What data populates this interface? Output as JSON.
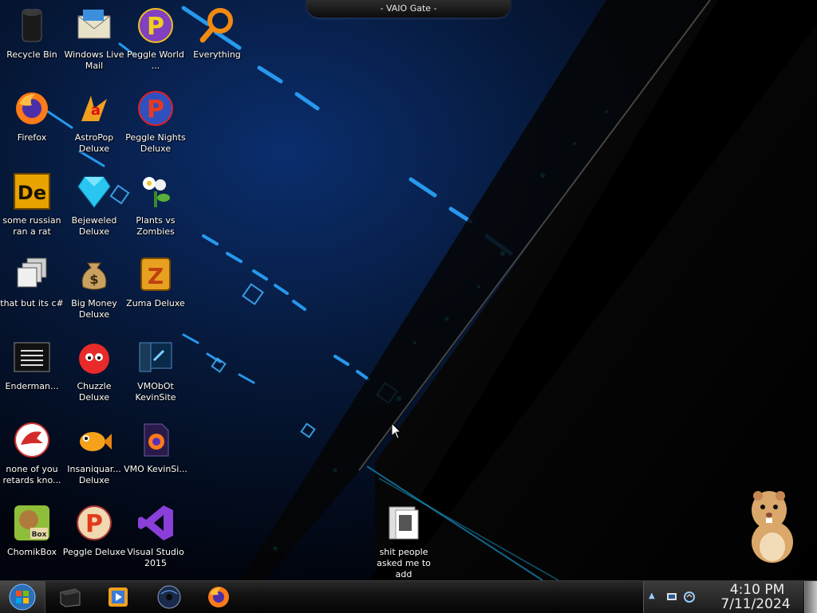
{
  "window": {
    "title": "- VAIO Gate -"
  },
  "desktop": {
    "icons": [
      {
        "label": "Recycle Bin"
      },
      {
        "label": "Windows Live Mail"
      },
      {
        "label": "Peggle World ..."
      },
      {
        "label": "Everything"
      },
      {
        "label": "Firefox"
      },
      {
        "label": "AstroPop Deluxe"
      },
      {
        "label": "Peggle Nights Deluxe"
      },
      {
        "label": "some russian ran a rat"
      },
      {
        "label": "Bejeweled Deluxe"
      },
      {
        "label": "Plants vs Zombies"
      },
      {
        "label": "that but its c#"
      },
      {
        "label": "Big Money Deluxe"
      },
      {
        "label": "Zuma Deluxe"
      },
      {
        "label": "Enderman..."
      },
      {
        "label": "Chuzzle Deluxe"
      },
      {
        "label": "VMObOt KevinSite"
      },
      {
        "label": "none of you retards kno..."
      },
      {
        "label": "Insaniquar... Deluxe"
      },
      {
        "label": "VMO KevinSi..."
      },
      {
        "label": "ChomikBox"
      },
      {
        "label": "Peggle Deluxe"
      },
      {
        "label": "Visual Studio 2015"
      },
      {
        "label": "shit people asked me to add"
      }
    ]
  },
  "taskbar": {
    "pinned": [
      {
        "icon": "media-center-icon"
      },
      {
        "icon": "media-player-icon"
      },
      {
        "icon": "dvd-player-icon"
      },
      {
        "icon": "firefox-icon"
      }
    ],
    "clock": {
      "time": "4:10 PM",
      "date": "7/11/2024"
    }
  },
  "colors": {
    "accent": "#1fd0ff",
    "wallpaper": "#02081c"
  }
}
